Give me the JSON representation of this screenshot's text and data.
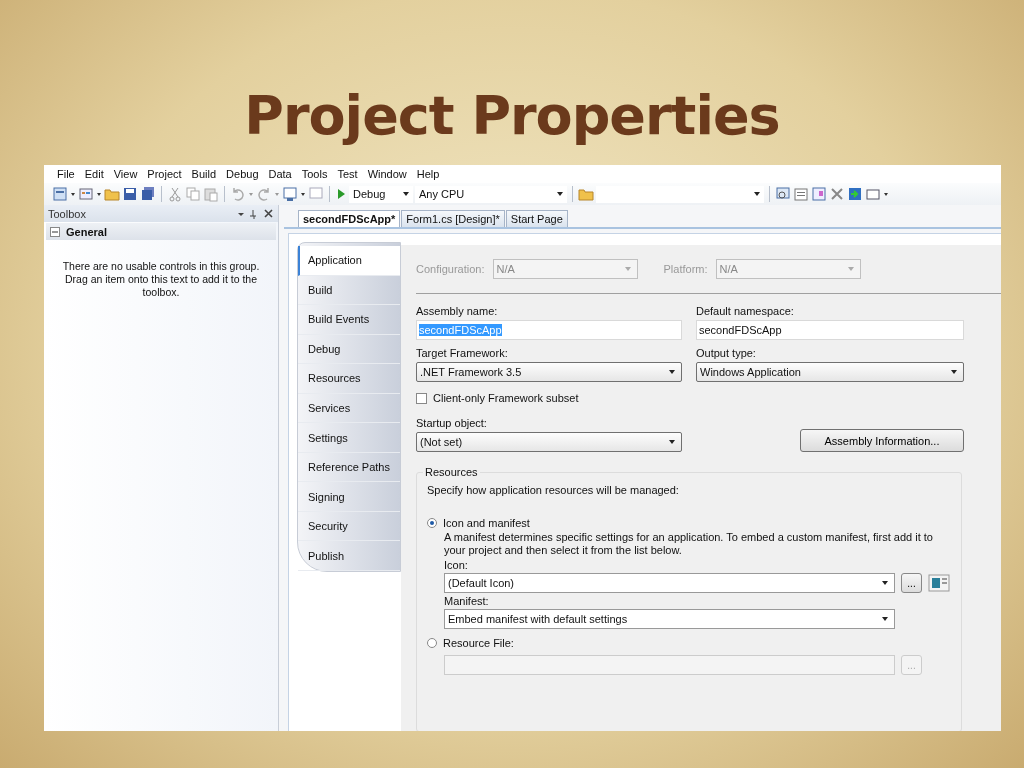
{
  "slide_title": "Project Properties",
  "menu": [
    "File",
    "Edit",
    "View",
    "Project",
    "Build",
    "Debug",
    "Data",
    "Tools",
    "Test",
    "Window",
    "Help"
  ],
  "toolbar": {
    "configuration": "Debug",
    "platform": "Any CPU"
  },
  "toolbox": {
    "title": "Toolbox",
    "group": "General",
    "expanded": true,
    "message": "There are no usable controls in this group. Drag an item onto this text to add it to the toolbox."
  },
  "doc_tabs": [
    {
      "label": "secondFDScApp*",
      "selected": true
    },
    {
      "label": "Form1.cs [Design]*",
      "selected": false
    },
    {
      "label": "Start Page",
      "selected": false
    }
  ],
  "page_tabs": [
    {
      "label": "Application",
      "selected": true
    },
    {
      "label": "Build",
      "selected": false
    },
    {
      "label": "Build Events",
      "selected": false
    },
    {
      "label": "Debug",
      "selected": false
    },
    {
      "label": "Resources",
      "selected": false
    },
    {
      "label": "Services",
      "selected": false
    },
    {
      "label": "Settings",
      "selected": false
    },
    {
      "label": "Reference Paths",
      "selected": false
    },
    {
      "label": "Signing",
      "selected": false
    },
    {
      "label": "Security",
      "selected": false
    },
    {
      "label": "Publish",
      "selected": false
    }
  ],
  "config_bar": {
    "configuration_label": "Configuration:",
    "configuration": "N/A",
    "platform_label": "Platform:",
    "platform": "N/A",
    "disabled": true
  },
  "assembly_name": {
    "label": "Assembly name:",
    "value": "secondFDScApp",
    "highlighted": true
  },
  "default_namespace": {
    "label": "Default namespace:",
    "value": "secondFDScApp"
  },
  "target_framework": {
    "label": "Target Framework:",
    "value": ".NET Framework 3.5"
  },
  "output_type": {
    "label": "Output type:",
    "value": "Windows Application"
  },
  "client_only": {
    "label": "Client-only Framework subset",
    "checked": false
  },
  "startup_object": {
    "label": "Startup object:",
    "value": "(Not set)"
  },
  "assembly_info_button": "Assembly Information...",
  "resources": {
    "title": "Resources",
    "hint": "Specify how application resources will be managed:",
    "options": [
      {
        "label": "Icon and manifest",
        "selected": true
      },
      {
        "label": "Resource File:",
        "selected": false
      }
    ],
    "description": "A manifest determines specific settings for an application. To embed a custom manifest, first add it to your project and then select it from the list below.",
    "icon_label": "Icon:",
    "icon_value": "(Default Icon)",
    "browse": "...",
    "manifest_label": "Manifest:",
    "manifest_value": "Embed manifest with default settings",
    "resource_browse": "..."
  }
}
